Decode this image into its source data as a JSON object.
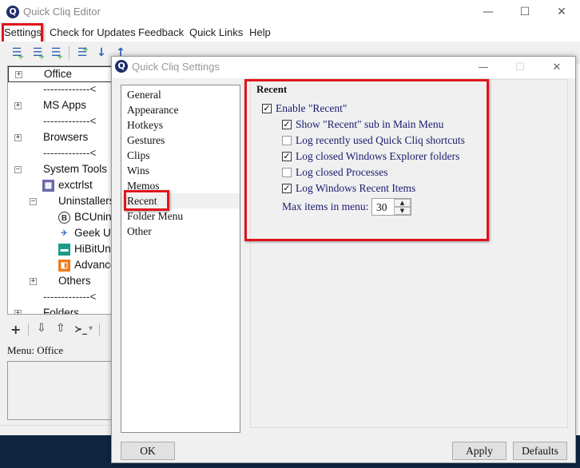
{
  "editor": {
    "title": "Quick Cliq Editor",
    "app_icon_glyph": "Q",
    "window_controls": {
      "minimize": "—",
      "maximize": "☐",
      "close": "✕"
    },
    "menu": [
      "Settings",
      "Check for Updates",
      "Feedback",
      "Quick Links",
      "Help"
    ],
    "toolbar_icons": [
      "add-item-icon",
      "add-submenu-icon",
      "add-separator-icon",
      "add-menu-icon",
      "move-down-icon",
      "move-up-icon",
      "delete-icon",
      "help-icon",
      "layout-icon"
    ],
    "tree": [
      {
        "label": "Office",
        "type": "menu",
        "expander": "+",
        "selected": true
      },
      {
        "label": "-------------<",
        "type": "separator"
      },
      {
        "label": "MS Apps",
        "type": "menu",
        "expander": "+"
      },
      {
        "label": "-------------<",
        "type": "separator"
      },
      {
        "label": "Browsers",
        "type": "menu",
        "expander": "+"
      },
      {
        "label": "-------------<",
        "type": "separator"
      },
      {
        "label": "System Tools",
        "type": "menu",
        "expander": "−"
      },
      {
        "label": "exctrlst",
        "type": "item",
        "icon": "app-icon"
      },
      {
        "label": "Uninstallers",
        "type": "submenu",
        "expander": "−"
      },
      {
        "label": "BCUninstaller",
        "type": "item",
        "icon": "bcuninstaller-icon"
      },
      {
        "label": "Geek Uninstaller",
        "type": "item",
        "icon": "geek-icon"
      },
      {
        "label": "HiBitUninstaller",
        "type": "item",
        "icon": "hibit-icon"
      },
      {
        "label": "Advanced",
        "type": "item",
        "icon": "advanced-icon"
      },
      {
        "label": "Others",
        "type": "submenu",
        "expander": "+"
      },
      {
        "label": "-------------<",
        "type": "separator"
      },
      {
        "label": "Folders",
        "type": "menu",
        "expander": "+"
      }
    ],
    "bottom_toolbar": {
      "add": "+",
      "down": "⇩",
      "up": "⇧",
      "command": "≻_",
      "dropdown": "▾"
    },
    "menu_label": "Menu: Office"
  },
  "dialog": {
    "title": "Quick Cliq Settings",
    "app_icon_glyph": "Q",
    "window_controls": {
      "minimize": "—",
      "maximize": "☐",
      "close": "✕"
    },
    "nav": [
      "General",
      "Appearance",
      "Hotkeys",
      "Gestures",
      "Clips",
      "Wins",
      "Memos",
      "Recent",
      "Folder Menu",
      "Other"
    ],
    "active_nav": "Recent",
    "group_title": "Recent",
    "options": [
      {
        "label": "Enable \"Recent\"",
        "checked": true,
        "indent": 0
      },
      {
        "label": "Show \"Recent\" sub in Main Menu",
        "checked": true,
        "indent": 1
      },
      {
        "label": "Log recently used Quick Cliq shortcuts",
        "checked": false,
        "indent": 1
      },
      {
        "label": "Log closed Windows Explorer folders",
        "checked": true,
        "indent": 1
      },
      {
        "label": "Log closed Processes",
        "checked": false,
        "indent": 1
      },
      {
        "label": "Log Windows Recent Items",
        "checked": true,
        "indent": 1
      }
    ],
    "max_items_label": "Max items in menu:",
    "max_items_value": "30",
    "buttons": {
      "ok": "OK",
      "apply": "Apply",
      "defaults": "Defaults"
    },
    "highlight_color": "#e0141a"
  }
}
